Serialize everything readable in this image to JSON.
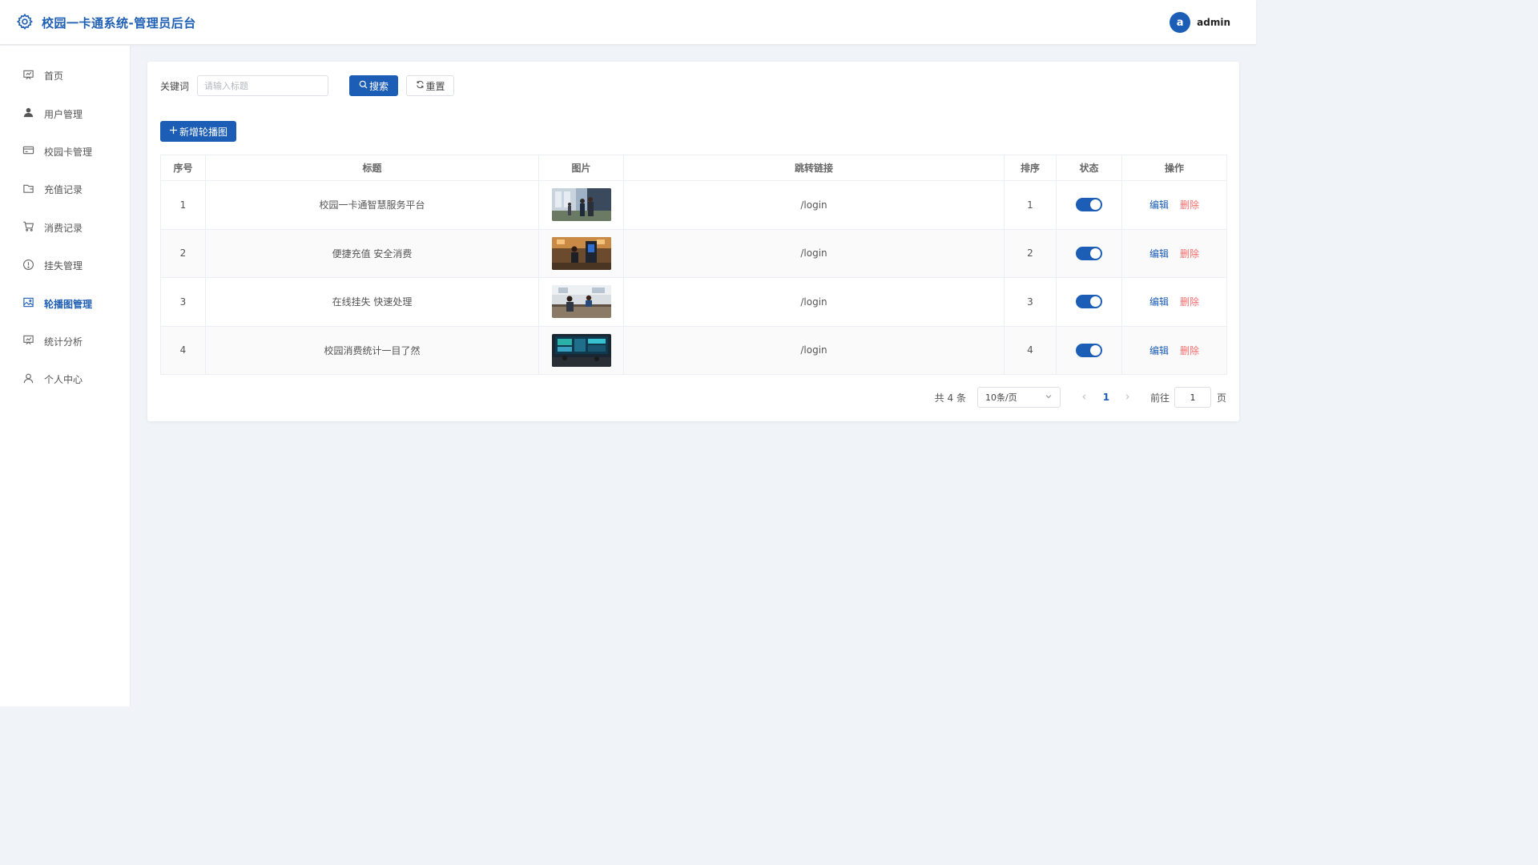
{
  "header": {
    "title": "校园一卡通系统-管理员后台",
    "avatar_letter": "a",
    "username": "admin"
  },
  "sidebar": {
    "items": [
      {
        "label": "首页",
        "icon": "dashboard-icon"
      },
      {
        "label": "用户管理",
        "icon": "user-icon"
      },
      {
        "label": "校园卡管理",
        "icon": "card-icon"
      },
      {
        "label": "充值记录",
        "icon": "wallet-icon"
      },
      {
        "label": "消费记录",
        "icon": "cart-icon"
      },
      {
        "label": "挂失管理",
        "icon": "warning-icon"
      },
      {
        "label": "轮播图管理",
        "icon": "picture-icon",
        "active": true
      },
      {
        "label": "统计分析",
        "icon": "chart-icon"
      },
      {
        "label": "个人中心",
        "icon": "profile-icon"
      }
    ]
  },
  "filter": {
    "keyword_label": "关键词",
    "keyword_placeholder": "请输入标题",
    "keyword_value": "",
    "search_label": "搜索",
    "reset_label": "重置"
  },
  "toolbar": {
    "add_label": "新增轮播图"
  },
  "table": {
    "columns": [
      "序号",
      "标题",
      "图片",
      "跳转链接",
      "排序",
      "状态",
      "操作"
    ],
    "rows": [
      {
        "index": "1",
        "title": "校园一卡通智慧服务平台",
        "image": "campus-entrance",
        "link": "/login",
        "sort": "1",
        "status": true,
        "edit": "编辑",
        "delete": "删除"
      },
      {
        "index": "2",
        "title": "便捷充值 安全消费",
        "image": "recharge-kiosk",
        "link": "/login",
        "sort": "2",
        "status": true,
        "edit": "编辑",
        "delete": "删除"
      },
      {
        "index": "3",
        "title": "在线挂失 快速处理",
        "image": "service-desk",
        "link": "/login",
        "sort": "3",
        "status": true,
        "edit": "编辑",
        "delete": "删除"
      },
      {
        "index": "4",
        "title": "校园消费统计一目了然",
        "image": "dashboard-screen",
        "link": "/login",
        "sort": "4",
        "status": true,
        "edit": "编辑",
        "delete": "删除"
      }
    ]
  },
  "pagination": {
    "total_text": "共 4 条",
    "page_size": "10条/页",
    "current_page": "1",
    "jump_label": "前往",
    "jump_value": "1",
    "page_suffix": "页"
  },
  "colors": {
    "primary": "#1c5db5",
    "danger": "#f56c6c",
    "background": "#f0f3f7"
  }
}
